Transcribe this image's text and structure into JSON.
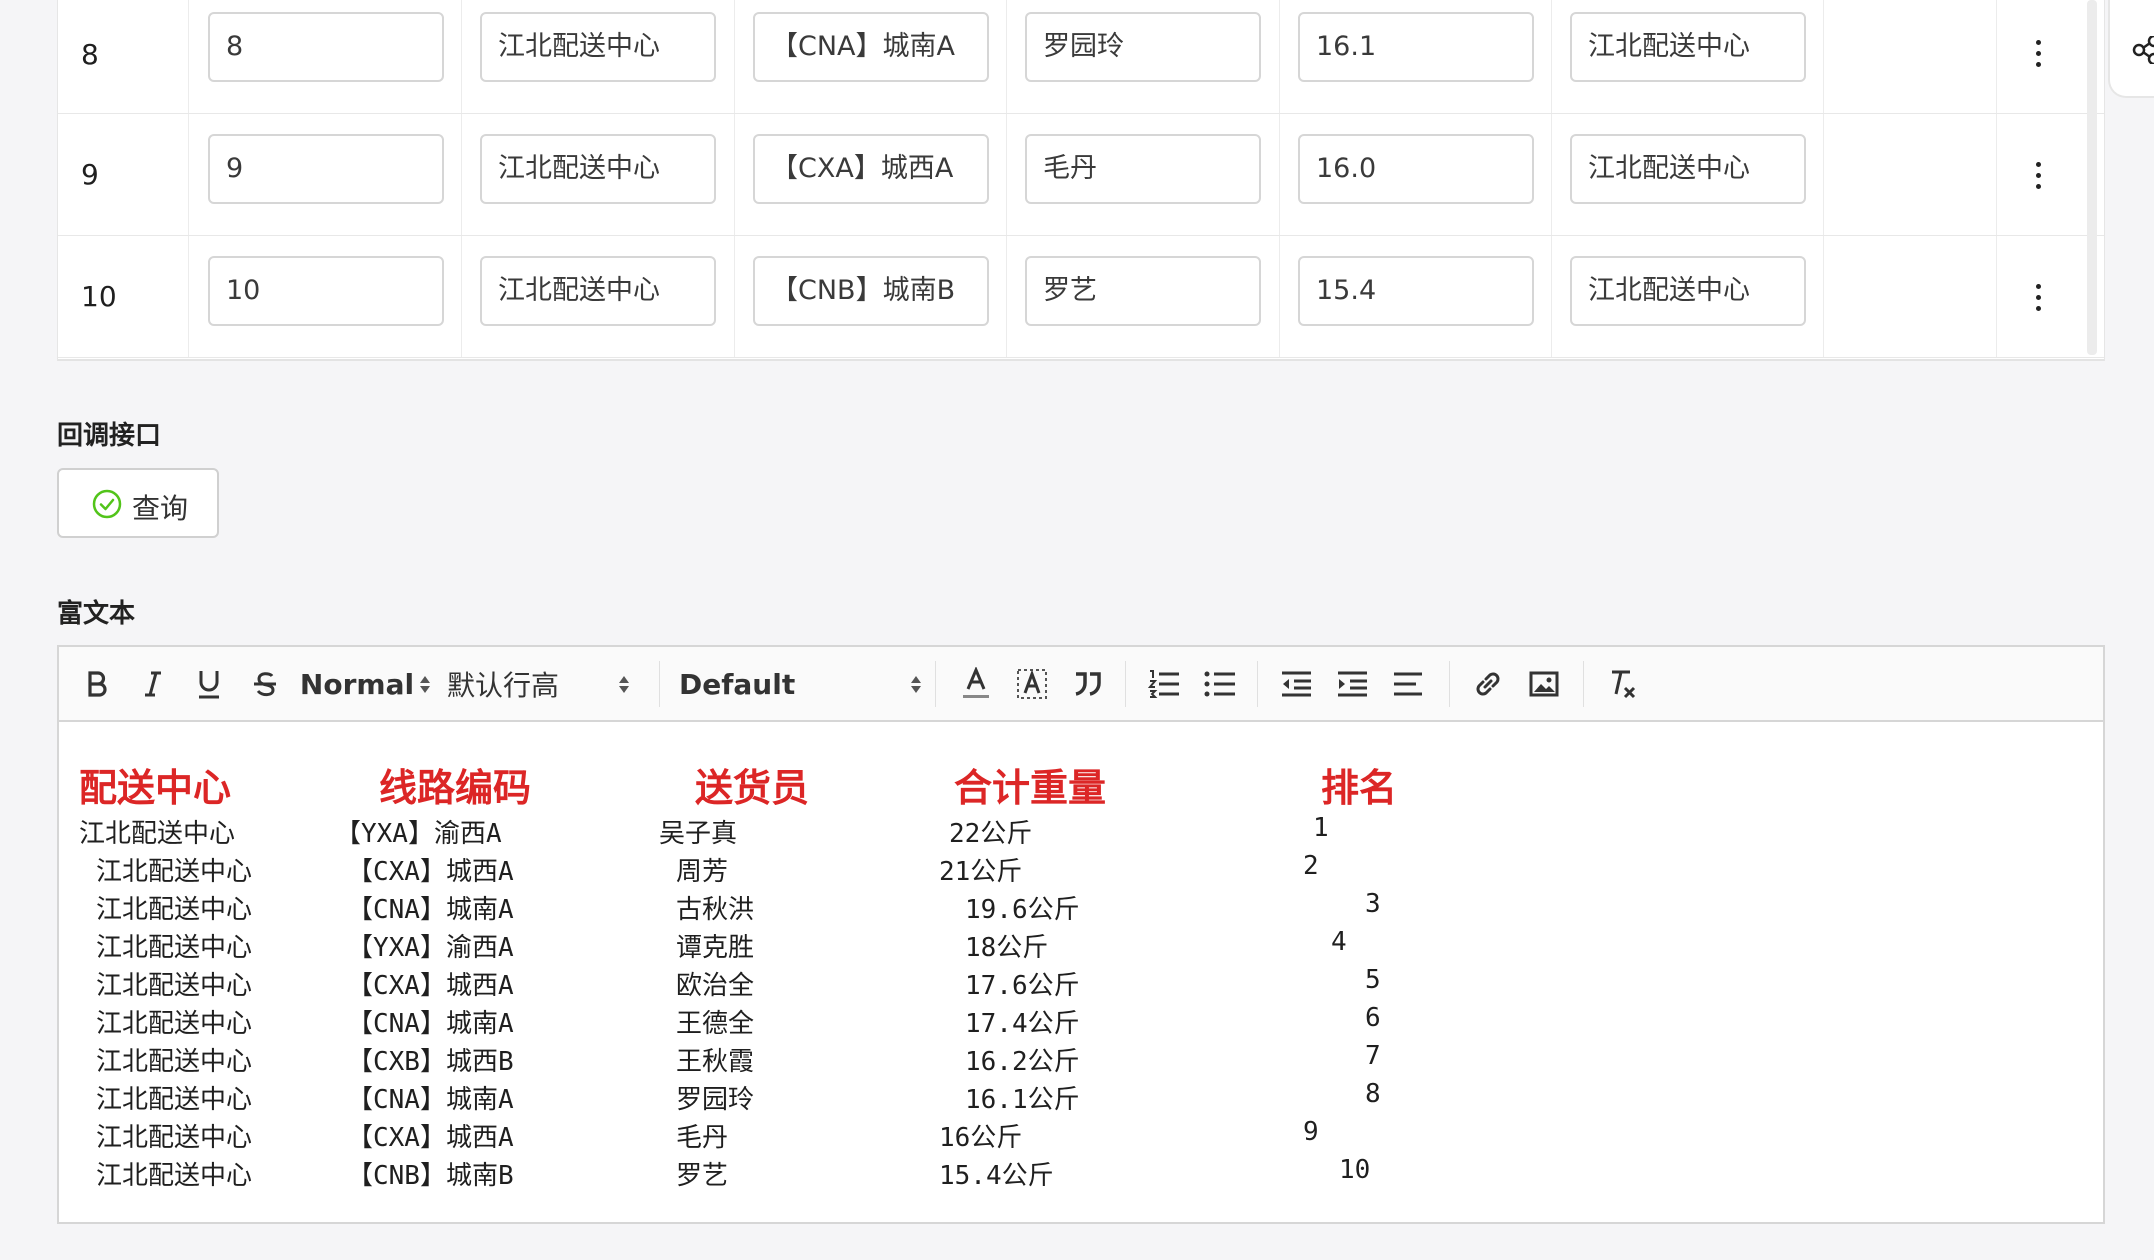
{
  "table": {
    "rows": [
      {
        "num": "8",
        "cells": [
          "8",
          "江北配送中心",
          "【CNA】城南A",
          "罗园玲",
          "16.1",
          "江北配送中心"
        ]
      },
      {
        "num": "9",
        "cells": [
          "9",
          "江北配送中心",
          "【CXA】城西A",
          "毛丹",
          "16.0",
          "江北配送中心"
        ]
      },
      {
        "num": "10",
        "cells": [
          "10",
          "江北配送中心",
          "【CNB】城南B",
          "罗艺",
          "15.4",
          "江北配送中心"
        ]
      }
    ]
  },
  "callback": {
    "title": "回调接口",
    "query_label": "查询"
  },
  "rich_text": {
    "title": "富文本",
    "toolbar": {
      "header_select": "Normal",
      "line_height_select": "默认行高",
      "font_select": "Default"
    },
    "headers": [
      "配送中心",
      "线路编码",
      "送货员",
      "合计重量",
      "排名"
    ],
    "lines": [
      [
        "江北配送中心",
        "【YXA】渝西A",
        "吴子真",
        "22公斤",
        "1"
      ],
      [
        "江北配送中心",
        "【CXA】城西A",
        "周芳",
        "21公斤",
        "2"
      ],
      [
        "江北配送中心",
        "【CNA】城南A",
        "古秋洪",
        "19.6公斤",
        "3"
      ],
      [
        "江北配送中心",
        "【YXA】渝西A",
        "谭克胜",
        "18公斤",
        "4"
      ],
      [
        "江北配送中心",
        "【CXA】城西A",
        "欧治全",
        "17.6公斤",
        "5"
      ],
      [
        "江北配送中心",
        "【CNA】城南A",
        "王德全",
        "17.4公斤",
        "6"
      ],
      [
        "江北配送中心",
        "【CXB】城西B",
        "王秋霞",
        "16.2公斤",
        "7"
      ],
      [
        "江北配送中心",
        "【CNA】城南A",
        "罗园玲",
        "16.1公斤",
        "8"
      ],
      [
        "江北配送中心",
        "【CXA】城西A",
        "毛丹",
        "16公斤",
        "9"
      ],
      [
        "江北配送中心",
        "【CNB】城南B",
        "罗艺",
        "15.4公斤",
        "10"
      ]
    ],
    "header_color": "#dc2626"
  },
  "colors": {
    "accent_check": "#52c41a"
  }
}
